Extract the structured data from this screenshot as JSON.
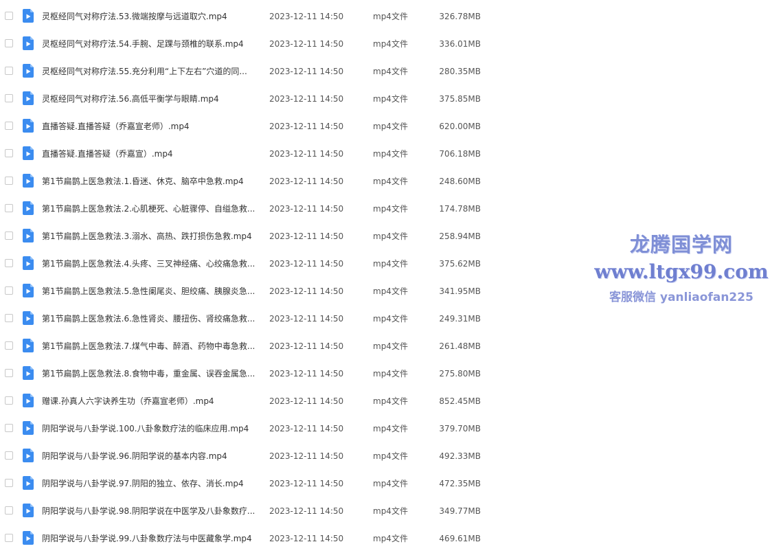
{
  "icons": {
    "checkbox": "checkbox-icon",
    "file": "video-file-icon"
  },
  "colors": {
    "file_icon": "#3b8cf0",
    "watermark": "#7f8fd6"
  },
  "files": [
    {
      "name": "灵枢经同气对称疗法.53.微端按摩与远道取穴.mp4",
      "date": "2023-12-11 14:50",
      "type": "mp4文件",
      "size": "326.78MB"
    },
    {
      "name": "灵枢经同气对称疗法.54.手腕、足踝与颈椎的联系.mp4",
      "date": "2023-12-11 14:50",
      "type": "mp4文件",
      "size": "336.01MB"
    },
    {
      "name": "灵枢经同气对称疗法.55.充分利用“上下左右”穴道的同...",
      "date": "2023-12-11 14:50",
      "type": "mp4文件",
      "size": "280.35MB"
    },
    {
      "name": "灵枢经同气对称疗法.56.高低平衡学与眼睛.mp4",
      "date": "2023-12-11 14:50",
      "type": "mp4文件",
      "size": "375.85MB"
    },
    {
      "name": "直播答疑.直播答疑（乔嘉宣老师）.mp4",
      "date": "2023-12-11 14:50",
      "type": "mp4文件",
      "size": "620.00MB"
    },
    {
      "name": "直播答疑.直播答疑（乔嘉宣）.mp4",
      "date": "2023-12-11 14:50",
      "type": "mp4文件",
      "size": "706.18MB"
    },
    {
      "name": "第1节扁鹊上医急救法.1.昏迷、休克、脑卒中急救.mp4",
      "date": "2023-12-11 14:50",
      "type": "mp4文件",
      "size": "248.60MB"
    },
    {
      "name": "第1节扁鹊上医急救法.2.心肌梗死、心脏骤停、自缢急救...",
      "date": "2023-12-11 14:50",
      "type": "mp4文件",
      "size": "174.78MB"
    },
    {
      "name": "第1节扁鹊上医急救法.3.溺水、高热、跌打损伤急救.mp4",
      "date": "2023-12-11 14:50",
      "type": "mp4文件",
      "size": "258.94MB"
    },
    {
      "name": "第1节扁鹊上医急救法.4.头疼、三叉神经痛、心绞痛急救...",
      "date": "2023-12-11 14:50",
      "type": "mp4文件",
      "size": "375.62MB"
    },
    {
      "name": "第1节扁鹊上医急救法.5.急性阑尾炎、胆绞痛、胰腺炎急...",
      "date": "2023-12-11 14:50",
      "type": "mp4文件",
      "size": "341.95MB"
    },
    {
      "name": "第1节扁鹊上医急救法.6.急性肾炎、腰扭伤、肾绞痛急救...",
      "date": "2023-12-11 14:50",
      "type": "mp4文件",
      "size": "249.31MB"
    },
    {
      "name": "第1节扁鹊上医急救法.7.煤气中毒、醉酒、药物中毒急救...",
      "date": "2023-12-11 14:50",
      "type": "mp4文件",
      "size": "261.48MB"
    },
    {
      "name": "第1节扁鹊上医急救法.8.食物中毒，重金属、误吞金属急...",
      "date": "2023-12-11 14:50",
      "type": "mp4文件",
      "size": "275.80MB"
    },
    {
      "name": "赠课.孙真人六字诀养生功（乔嘉宣老师）.mp4",
      "date": "2023-12-11 14:50",
      "type": "mp4文件",
      "size": "852.45MB"
    },
    {
      "name": "阴阳学说与八卦学说.100.八卦象数疗法的临床应用.mp4",
      "date": "2023-12-11 14:50",
      "type": "mp4文件",
      "size": "379.70MB"
    },
    {
      "name": "阴阳学说与八卦学说.96.阴阳学说的基本内容.mp4",
      "date": "2023-12-11 14:50",
      "type": "mp4文件",
      "size": "492.33MB"
    },
    {
      "name": "阴阳学说与八卦学说.97.阴阳的独立、依存、消长.mp4",
      "date": "2023-12-11 14:50",
      "type": "mp4文件",
      "size": "472.35MB"
    },
    {
      "name": "阴阳学说与八卦学说.98.阴阳学说在中医学及八卦象数疗...",
      "date": "2023-12-11 14:50",
      "type": "mp4文件",
      "size": "349.77MB"
    },
    {
      "name": "阴阳学说与八卦学说.99.八卦象数疗法与中医藏象学.mp4",
      "date": "2023-12-11 14:50",
      "type": "mp4文件",
      "size": "469.61MB"
    }
  ],
  "watermark": {
    "title": "龙腾国学网",
    "url": "www.ltgx99.com",
    "contact": "客服微信 yanliaofan225"
  }
}
